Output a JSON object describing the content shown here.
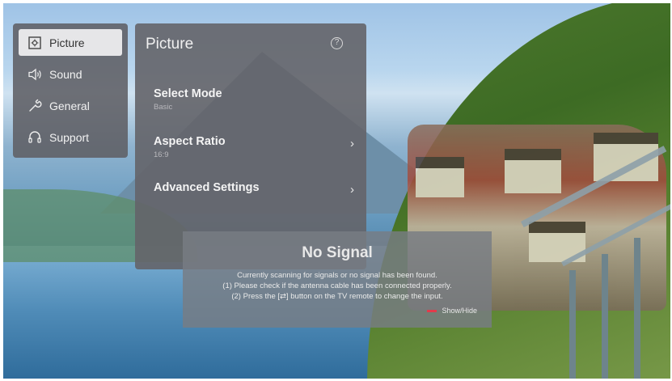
{
  "side_menu": {
    "items": [
      {
        "label": "Picture",
        "icon": "picture-icon",
        "selected": true
      },
      {
        "label": "Sound",
        "icon": "speaker-icon",
        "selected": false
      },
      {
        "label": "General",
        "icon": "wrench-icon",
        "selected": false
      },
      {
        "label": "Support",
        "icon": "headset-icon",
        "selected": false
      }
    ]
  },
  "panel": {
    "title": "Picture",
    "help_icon": "?",
    "settings": [
      {
        "label": "Select Mode",
        "value": "Basic",
        "chevron": ""
      },
      {
        "label": "Aspect Ratio",
        "value": "16:9",
        "chevron": "›"
      },
      {
        "label": "Advanced Settings",
        "value": "",
        "chevron": "›"
      }
    ]
  },
  "no_signal": {
    "title": "No Signal",
    "lines": [
      "Currently scanning for signals or no signal has been found.",
      "(1) Please check if the antenna cable has been connected properly.",
      "(2) Press the [⇄] button on the TV remote to change the input."
    ],
    "show_hide": "Show/Hide",
    "accent_color": "#e23b4b"
  }
}
